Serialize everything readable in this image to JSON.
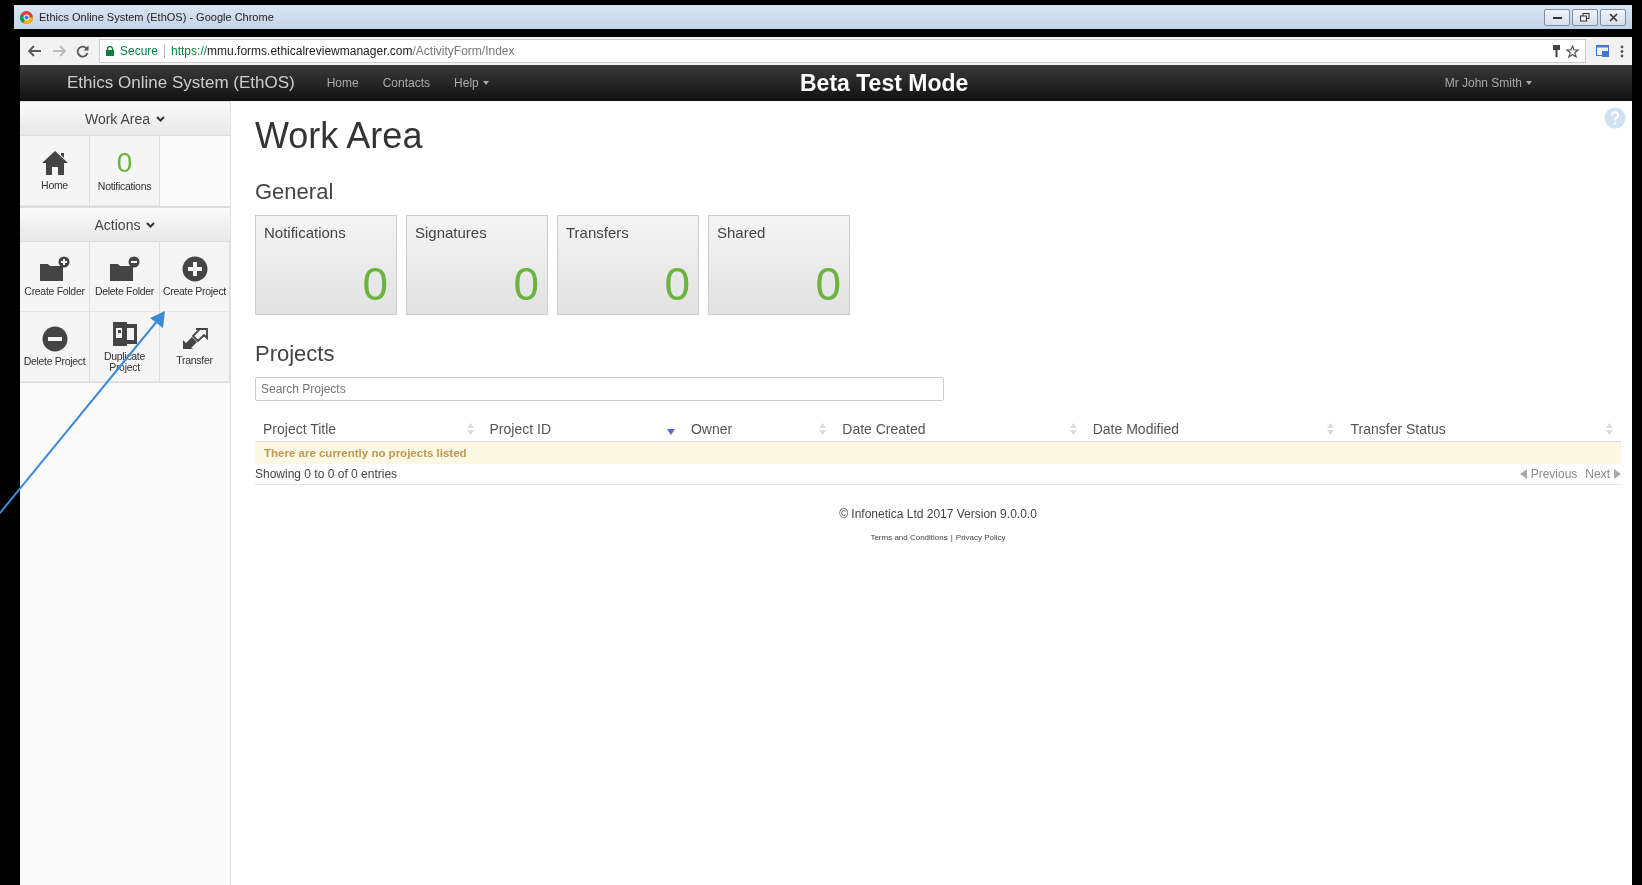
{
  "window": {
    "title": "Ethics Online System (EthOS) - Google Chrome"
  },
  "browser": {
    "secure_label": "Secure",
    "url_scheme": "https://",
    "url_host": "mmu.forms.ethicalreviewmanager.com",
    "url_path": "/ActivityForm/Index"
  },
  "navbar": {
    "brand": "Ethics Online System (EthOS)",
    "links": [
      {
        "label": "Home",
        "dropdown": false
      },
      {
        "label": "Contacts",
        "dropdown": false
      },
      {
        "label": "Help",
        "dropdown": true
      }
    ],
    "banner": "Beta Test Mode",
    "user": "Mr John Smith"
  },
  "sidebar": {
    "sections": [
      {
        "title": "Work Area",
        "tiles": [
          {
            "kind": "home",
            "label": "Home"
          },
          {
            "kind": "count",
            "count": "0",
            "label": "Notifications"
          }
        ]
      },
      {
        "title": "Actions",
        "tiles": [
          {
            "kind": "folder-add",
            "label": "Create Folder"
          },
          {
            "kind": "folder-remove",
            "label": "Delete Folder"
          },
          {
            "kind": "add",
            "label": "Create Project"
          },
          {
            "kind": "remove",
            "label": "Delete Project"
          },
          {
            "kind": "duplicate",
            "label": "Duplicate Project"
          },
          {
            "kind": "transfer",
            "label": "Transfer"
          }
        ]
      }
    ]
  },
  "main": {
    "title": "Work Area",
    "general_title": "General",
    "cards": [
      {
        "label": "Notifications",
        "count": "0"
      },
      {
        "label": "Signatures",
        "count": "0"
      },
      {
        "label": "Transfers",
        "count": "0"
      },
      {
        "label": "Shared",
        "count": "0"
      }
    ],
    "projects_title": "Projects",
    "table": {
      "search_placeholder": "Search Projects",
      "columns": [
        {
          "label": "Project Title",
          "sorted": false
        },
        {
          "label": "Project ID",
          "sorted": true
        },
        {
          "label": "Owner",
          "sorted": false
        },
        {
          "label": "Date Created",
          "sorted": false
        },
        {
          "label": "Date Modified",
          "sorted": false
        },
        {
          "label": "Transfer Status",
          "sorted": false
        }
      ],
      "empty_message": "There are currently no projects listed",
      "info": "Showing 0 to 0 of 0 entries",
      "pager": [
        "Previous",
        "Next"
      ]
    }
  },
  "footer": {
    "copyright": "© Infonetica Ltd 2017 Version 9.0.0.0",
    "links": [
      "Terms and Conditions",
      "Privacy Policy"
    ],
    "separator": "|"
  }
}
